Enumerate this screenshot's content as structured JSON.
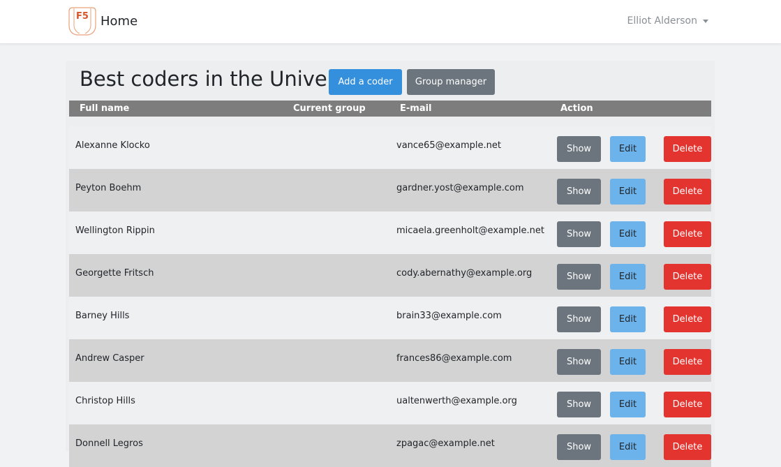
{
  "navbar": {
    "logo_text": "F5",
    "brand": "Home",
    "user": "Elliot Alderson"
  },
  "page": {
    "title": "Best coders in the Universe",
    "add_button": "Add a coder",
    "group_button": "Group manager"
  },
  "table": {
    "headers": [
      "Full name",
      "Current group",
      "E-mail",
      "Action"
    ],
    "actions": {
      "show": "Show",
      "edit": "Edit",
      "delete": "Delete"
    },
    "rows": [
      {
        "name": "Alexanne Klocko",
        "group": "",
        "email": "vance65@example.net"
      },
      {
        "name": "Peyton Boehm",
        "group": "",
        "email": "gardner.yost@example.com"
      },
      {
        "name": "Wellington Rippin",
        "group": "",
        "email": "micaela.greenholt@example.net"
      },
      {
        "name": "Georgette Fritsch",
        "group": "",
        "email": "cody.abernathy@example.org"
      },
      {
        "name": "Barney Hills",
        "group": "",
        "email": "brain33@example.com"
      },
      {
        "name": "Andrew Casper",
        "group": "",
        "email": "frances86@example.com"
      },
      {
        "name": "Christop Hills",
        "group": "",
        "email": "ualtenwerth@example.org"
      },
      {
        "name": "Donnell Legros",
        "group": "",
        "email": "zpagac@example.net"
      }
    ]
  },
  "colors": {
    "primary": "#3490dc",
    "secondary": "#6c757d",
    "info": "#6cb2eb",
    "danger": "#e3342f",
    "header": "#7d7d7d"
  }
}
